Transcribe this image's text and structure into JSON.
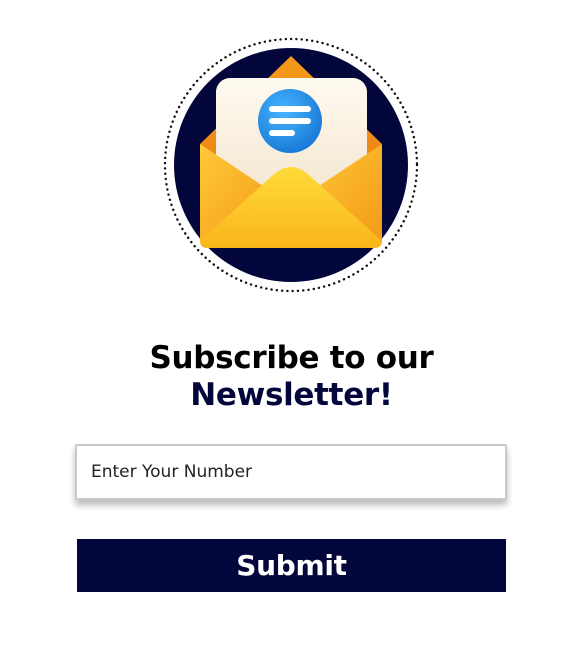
{
  "hero": {
    "icon": "open-envelope-newsletter-icon",
    "colors": {
      "circle": "#03063a",
      "envelope": "#f7b21f",
      "letter": "#fbf3e6",
      "badge": "#1e88e5"
    }
  },
  "headline": {
    "line1": "Subscribe to our",
    "line2": "Newsletter!"
  },
  "form": {
    "input_placeholder": "Enter Your Number",
    "input_value": "",
    "submit_label": "Submit"
  },
  "colors": {
    "accent": "#03063a",
    "text": "#000000",
    "background": "#ffffff"
  }
}
